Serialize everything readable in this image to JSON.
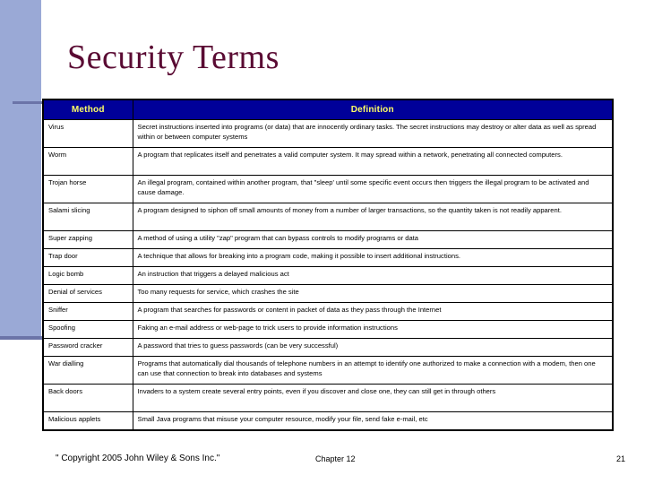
{
  "slide": {
    "title": "Security Terms",
    "title_color": "#5a0b33",
    "accent_band_color": "#9aa9d6",
    "accent_line_color": "#6b74a8",
    "header_bg_color": "#000099",
    "header_text_color": "#ffff66"
  },
  "table": {
    "columns": [
      "Method",
      "Definition"
    ],
    "rows": [
      {
        "method": "Virus",
        "definition": "Secret instructions inserted into programs (or data) that are innocently ordinary tasks. The secret instructions may destroy or alter data as well as spread within or between computer systems",
        "lines": 2
      },
      {
        "method": "Worm",
        "definition": "A program that replicates itself and penetrates a valid computer system. It may spread within a network, penetrating all connected computers.",
        "lines": 2
      },
      {
        "method": "Trojan horse",
        "definition": "An illegal program, contained within another program, that \"sleep' until some specific event occurs then triggers the illegal program to be activated and cause damage.",
        "lines": 2
      },
      {
        "method": "Salami slicing",
        "definition": "A program designed to siphon off small amounts of money from a number of larger transactions, so  the quantity taken is not readily apparent.",
        "lines": 2
      },
      {
        "method": "Super zapping",
        "definition": "A method of using a utility \"zap\" program that can bypass controls to modify programs or data",
        "lines": 1
      },
      {
        "method": "Trap door",
        "definition": "A technique that allows for breaking into a program code, making it possible to insert additional instructions.",
        "lines": 1
      },
      {
        "method": "Logic bomb",
        "definition": "An instruction that triggers a delayed malicious act",
        "lines": 1
      },
      {
        "method": "Denial of services",
        "definition": "Too many requests for service, which crashes the site",
        "lines": 1
      },
      {
        "method": "Sniffer",
        "definition": "A program that searches for passwords or content in packet of data as they pass through the Internet",
        "lines": 1
      },
      {
        "method": "Spoofing",
        "definition": "Faking an e-mail address or web-page to trick users to provide information instructions",
        "lines": 1
      },
      {
        "method": "Password cracker",
        "definition": "A password that tries to guess passwords (can be very successful)",
        "lines": 1
      },
      {
        "method": "War dialling",
        "definition": "Programs that automatically  dial thousands of telephone numbers in an attempt to identify one authorized to make a connection with a modem, then one can use that connection to break into databases and systems",
        "lines": 2
      },
      {
        "method": "Back doors",
        "definition": "Invaders to a system  create several entry points, even if you discover and close  one, they can still get in through others",
        "lines": 2
      },
      {
        "method": "Malicious applets",
        "definition": "Small Java programs that misuse your computer resource, modify your file, send fake e-mail, etc",
        "lines": 1
      }
    ]
  },
  "footer": {
    "copyright": "\" Copyright 2005 John Wiley & Sons Inc.\"",
    "chapter": "Chapter 12",
    "page_number": "21"
  }
}
